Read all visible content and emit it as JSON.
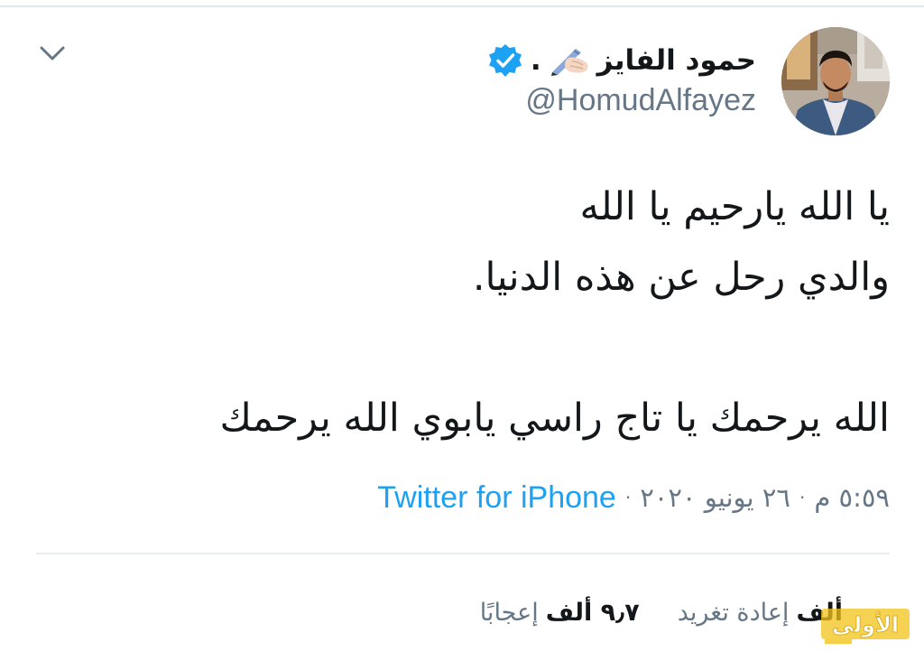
{
  "tweet": {
    "author": {
      "display_name": "حمود الفايز",
      "name_suffix": ".",
      "emoji_icon": "writing-hand-emoji",
      "verified_icon": "verified-badge-icon",
      "handle": "@HomudAlfayez",
      "avatar_icon": "avatar-photo"
    },
    "menu_icon": "chevron-down-icon",
    "text_lines": [
      "يا الله يارحيم يا الله",
      "والدي رحل عن هذه الدنيا.",
      "",
      "الله يرحمك يا تاج راسي يابوي الله يرحمك"
    ],
    "meta": {
      "time": "٥:٥٩ م",
      "date": "٢٦ يونيو ٢٠٢٠",
      "separator": "·",
      "source": "Twitter for iPhone"
    },
    "stats": {
      "retweets_count": "ألف",
      "retweets_label": "إعادة تغريد",
      "likes_count": "٩٫٧ ألف",
      "likes_label": "إعجابًا"
    }
  },
  "watermark": {
    "text": "الأولى"
  },
  "colors": {
    "text_primary": "#14171a",
    "text_secondary": "#657786",
    "link_blue": "#1da1f2",
    "verified_blue": "#1da1f2",
    "divider": "#e6ecf0",
    "watermark_yellow": "#f2c318"
  }
}
